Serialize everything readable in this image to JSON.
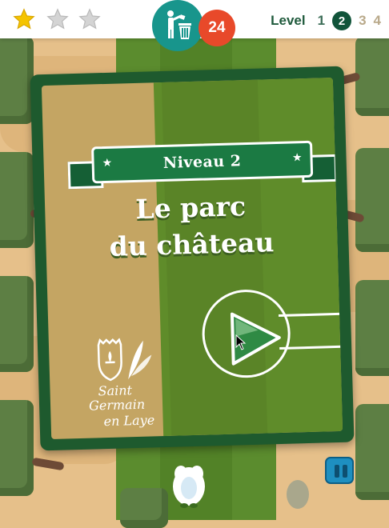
{
  "header": {
    "stars": [
      {
        "icon": "star-icon",
        "state": "filled",
        "color": "#f5c400"
      },
      {
        "icon": "star-icon",
        "state": "empty",
        "color": "#c9c9c9"
      },
      {
        "icon": "star-icon",
        "state": "empty",
        "color": "#c9c9c9"
      }
    ],
    "trash_icon": "trash-bin-icon",
    "trash_count": "24",
    "level_label": "Level",
    "levels": [
      "1",
      "2",
      "3",
      "4"
    ],
    "current_level": "2"
  },
  "card": {
    "ribbon_text": "Niveau 2",
    "title_line1": "Le parc",
    "title_line2": "du château",
    "play_icon": "play-icon"
  },
  "logo": {
    "line1": "Saint",
    "line2": "Germain",
    "line3": "en Laye"
  },
  "controls": {
    "pause_icon": "pause-icon"
  },
  "colors": {
    "accent_teal": "#18958c",
    "badge_red": "#e8492a",
    "level_active": "#11543a",
    "ribbon_green": "#1b7a43"
  }
}
